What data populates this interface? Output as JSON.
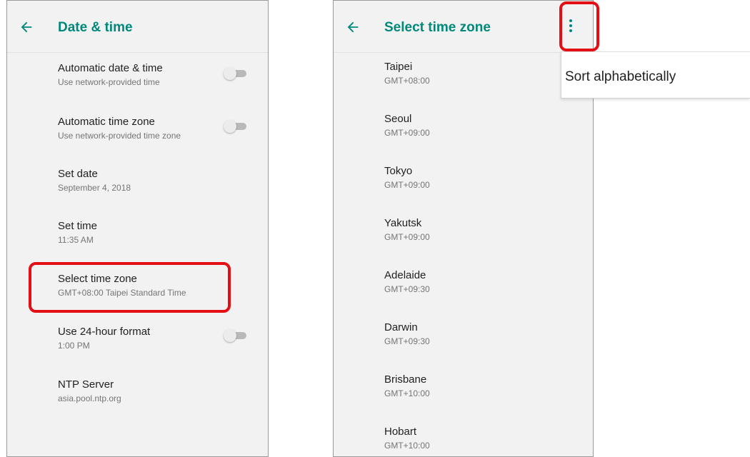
{
  "colors": {
    "accent": "#00897b",
    "highlight": "#e30f14",
    "background": "#f2f2f2"
  },
  "date_time_screen": {
    "title": "Date & time",
    "back_icon": "arrow-left-icon",
    "items": [
      {
        "title": "Automatic date & time",
        "summary": "Use network-provided time",
        "toggle": "off"
      },
      {
        "title": "Automatic time zone",
        "summary": "Use network-provided time zone",
        "toggle": "off"
      },
      {
        "title": "Set date",
        "summary": "September 4, 2018"
      },
      {
        "title": "Set time",
        "summary": "11:35 AM"
      },
      {
        "title": "Select time zone",
        "summary": "GMT+08:00 Taipei Standard Time",
        "highlighted": true
      },
      {
        "title": "Use 24-hour format",
        "summary": "1:00 PM",
        "toggle": "off"
      },
      {
        "title": "NTP Server",
        "summary": "asia.pool.ntp.org"
      }
    ]
  },
  "time_zone_screen": {
    "title": "Select time zone",
    "back_icon": "arrow-left-icon",
    "overflow_icon": "more-vert-icon",
    "zones": [
      {
        "name": "Taipei",
        "offset": "GMT+08:00"
      },
      {
        "name": "Seoul",
        "offset": "GMT+09:00"
      },
      {
        "name": "Tokyo",
        "offset": "GMT+09:00"
      },
      {
        "name": "Yakutsk",
        "offset": "GMT+09:00"
      },
      {
        "name": "Adelaide",
        "offset": "GMT+09:30"
      },
      {
        "name": "Darwin",
        "offset": "GMT+09:30"
      },
      {
        "name": "Brisbane",
        "offset": "GMT+10:00"
      },
      {
        "name": "Hobart",
        "offset": "GMT+10:00"
      }
    ]
  },
  "overflow_menu": {
    "items": [
      {
        "label": "Sort alphabetically"
      }
    ]
  }
}
